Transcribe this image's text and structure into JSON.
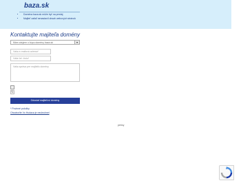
{
  "banner": {
    "domain": "baza.sk",
    "lines": [
      "Doména baza.sk môže byť na predaj",
      "Majiteľ zatiaľ nenastavil obsah webových stránok"
    ]
  },
  "form": {
    "heading": "Kontaktujte majiteľa domény",
    "select_value": "Mám záujem o kúpu domény baza.sk",
    "email_placeholder": "Vaša e-mailová adresa*",
    "phone_placeholder": "Váše tel. číslo*",
    "message_placeholder": "Vaša správa pre majiteľa domény",
    "captcha_refresh": "↻",
    "submit_label": "Odoslať majiteľovi domény",
    "required_note": "* Povinné položky",
    "owner_link": "Ohodnoťte Vo Hudaca je neuleuhnel"
  },
  "footer": {
    "text": "pericy"
  },
  "recaptcha": {
    "icon": "recaptcha-icon"
  }
}
